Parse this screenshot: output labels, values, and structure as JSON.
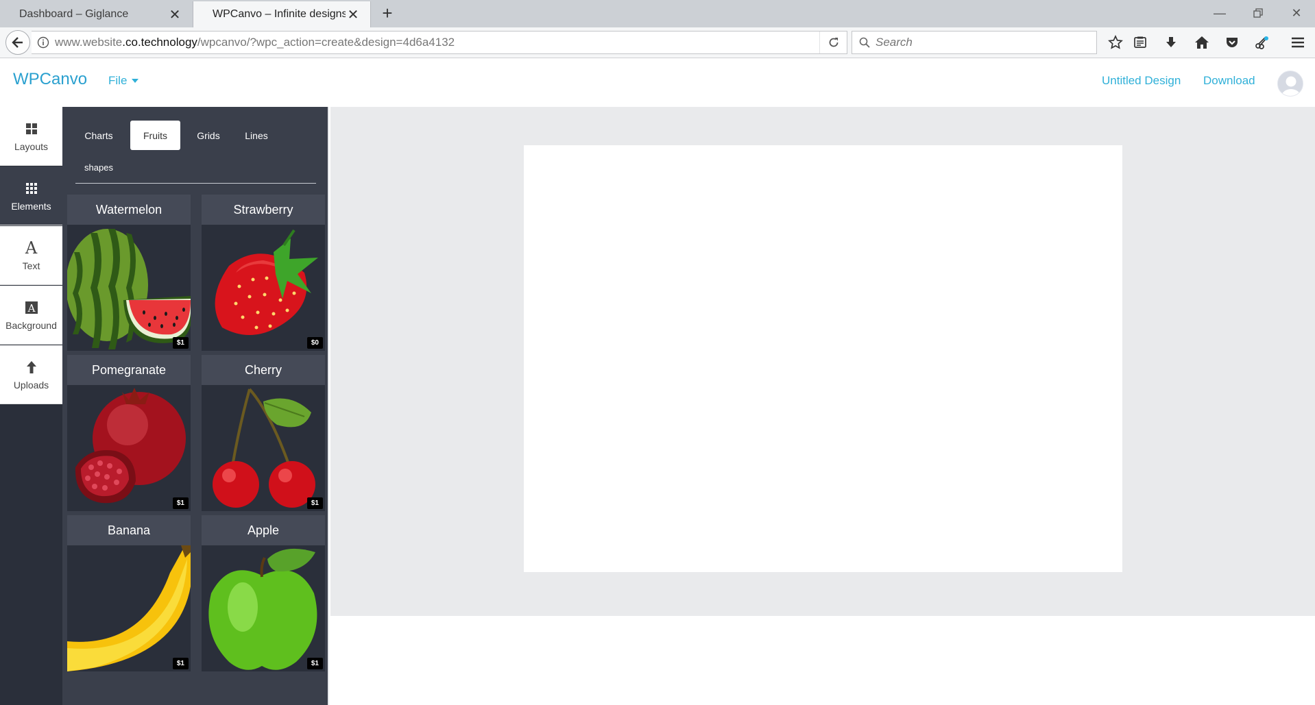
{
  "browser": {
    "tabs": [
      {
        "title": "Dashboard – Giglance",
        "active": false
      },
      {
        "title": "WPCanvo – Infinite designs in m",
        "active": true
      }
    ],
    "url": {
      "prefix": "www.website",
      "domain": ".co.technology",
      "path": "/wpcanvo/?wpc_action=create&design=4d6a4132"
    },
    "search_placeholder": "Search"
  },
  "app": {
    "logo": "WPCanvo",
    "file_menu": "File",
    "design_name": "Untitled Design",
    "download": "Download"
  },
  "rail": {
    "items": [
      {
        "label": "Layouts",
        "icon": "layouts-icon"
      },
      {
        "label": "Elements",
        "icon": "elements-icon",
        "active": true
      },
      {
        "label": "Text",
        "icon": "text-icon"
      },
      {
        "label": "Background",
        "icon": "background-icon"
      },
      {
        "label": "Uploads",
        "icon": "upload-icon"
      }
    ]
  },
  "panel": {
    "categories": [
      "Charts",
      "Fruits",
      "Grids",
      "Lines",
      "shapes"
    ],
    "active_category": "Fruits",
    "items": [
      {
        "name": "Watermelon",
        "price": "$1"
      },
      {
        "name": "Strawberry",
        "price": "$0"
      },
      {
        "name": "Pomegranate",
        "price": "$1"
      },
      {
        "name": "Cherry",
        "price": "$1"
      },
      {
        "name": "Banana",
        "price": "$1"
      },
      {
        "name": "Apple",
        "price": "$1"
      }
    ]
  },
  "colors": {
    "accent": "#2fb0d8",
    "rail_bg": "#2a2f3a",
    "panel_bg": "#3a3f4b",
    "workspace_bg": "#e9eaec"
  }
}
